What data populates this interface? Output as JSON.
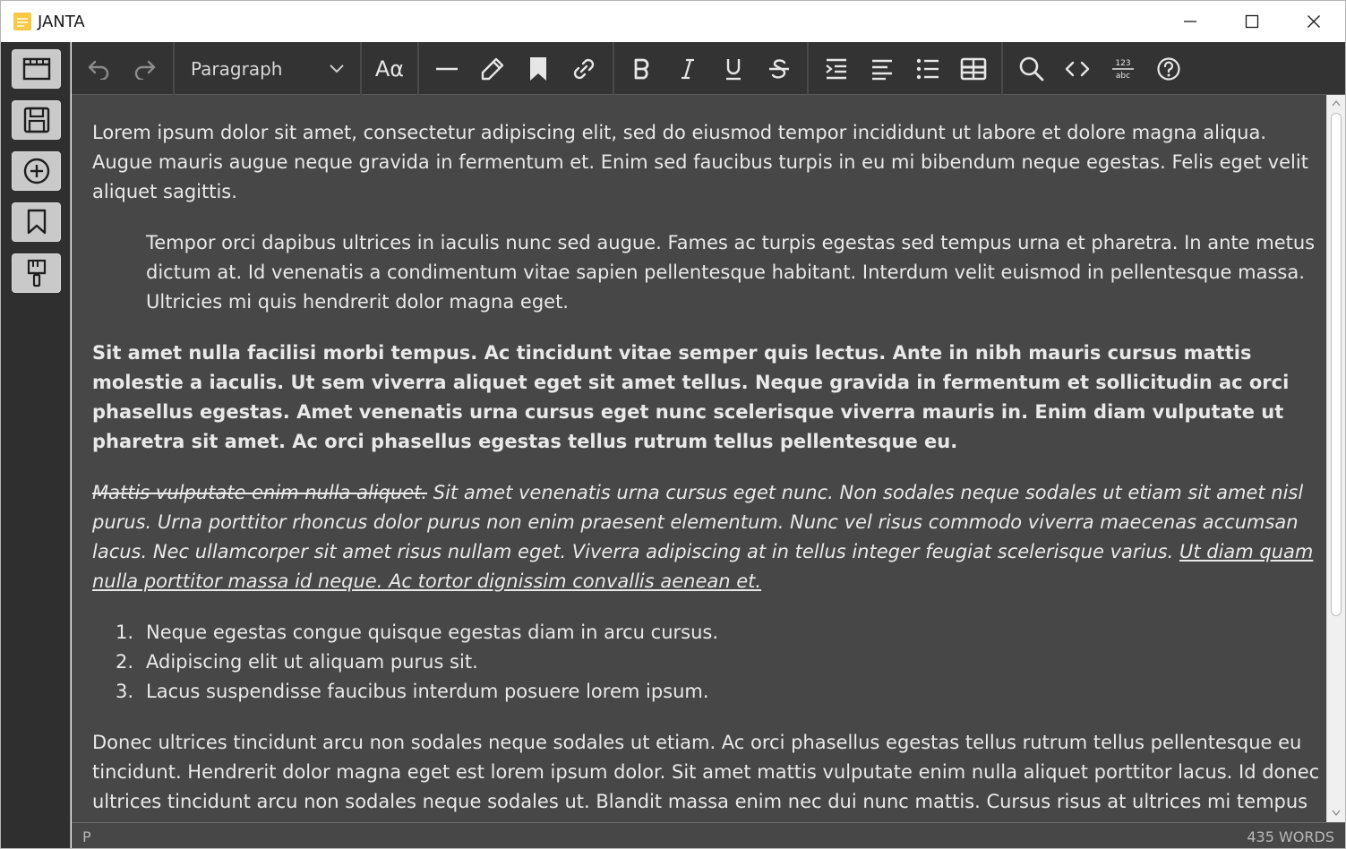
{
  "window": {
    "title": "JANTA",
    "minimize_icon": "minimize-icon",
    "maximize_icon": "maximize-icon",
    "close_icon": "close-icon"
  },
  "sidebar": {
    "items": [
      {
        "name": "open-file",
        "icon": "folder-icon"
      },
      {
        "name": "save",
        "icon": "floppy-disk-icon"
      },
      {
        "name": "new",
        "icon": "plus-circle-icon"
      },
      {
        "name": "bookmarks",
        "icon": "bookmark-icon"
      },
      {
        "name": "theme",
        "icon": "paintbrush-icon"
      }
    ]
  },
  "toolbar": {
    "paragraph_style": "Paragraph",
    "font_label": "Aα",
    "items": [
      "undo-icon",
      "redo-icon",
      "font-size-icon",
      "horizontal-rule-icon",
      "highlighter-icon",
      "bookmark-icon",
      "link-icon",
      "bold-icon",
      "italic-icon",
      "underline-icon",
      "strikethrough-icon",
      "indent-icon",
      "align-left-icon",
      "bullet-list-icon",
      "table-icon",
      "search-icon",
      "code-icon",
      "word-count-icon",
      "help-icon"
    ]
  },
  "editor": {
    "p1": "Lorem ipsum dolor sit amet, consectetur adipiscing elit, sed do eiusmod tempor incididunt ut labore et dolore magna aliqua. Augue mauris augue neque gravida in fermentum et. Enim sed faucibus turpis in eu mi bibendum neque egestas. Felis eget velit aliquet sagittis.",
    "p2": "Tempor orci dapibus ultrices in iaculis nunc sed augue. Fames ac turpis egestas sed tempus urna et pharetra. In ante metus dictum at. Id venenatis a condimentum vitae sapien pellentesque habitant. Interdum velit euismod in pellentesque massa. Ultricies mi quis hendrerit dolor magna eget.",
    "p3": "Sit amet nulla facilisi morbi tempus. Ac tincidunt vitae semper quis lectus. Ante in nibh mauris cursus mattis molestie a iaculis. Ut sem viverra aliquet eget sit amet tellus. Neque gravida in fermentum et sollicitudin ac orci phasellus egestas. Amet venenatis urna cursus eget nunc scelerisque viverra mauris in. Enim diam vulputate ut pharetra sit amet. Ac orci phasellus egestas tellus rutrum tellus pellentesque eu.",
    "p4_strike": "Mattis vulputate enim nulla aliquet.",
    "p4_italic": " Sit amet venenatis urna cursus eget nunc. Non sodales neque sodales ut etiam sit amet nisl purus. Urna porttitor rhoncus dolor purus non enim praesent elementum. Nunc vel risus commodo viverra maecenas accumsan lacus. Nec ullamcorper sit amet risus nullam eget. Viverra adipiscing at in tellus integer feugiat scelerisque varius. ",
    "p4_underline": "Ut diam quam nulla porttitor massa id neque. Ac tortor dignissim convallis aenean et.",
    "list": [
      {
        "num": "1.",
        "text": "Neque egestas congue quisque egestas diam in arcu cursus."
      },
      {
        "num": "2.",
        "text": "Adipiscing elit ut aliquam purus sit."
      },
      {
        "num": "3.",
        "text": "Lacus suspendisse faucibus interdum posuere lorem ipsum."
      }
    ],
    "p5": "Donec ultrices tincidunt arcu non sodales neque sodales ut etiam. Ac orci phasellus egestas tellus rutrum tellus pellentesque eu tincidunt. Hendrerit dolor magna eget est lorem ipsum dolor. Sit amet mattis vulputate enim nulla aliquet porttitor lacus. Id donec ultrices tincidunt arcu non sodales neque sodales ut. Blandit massa enim nec dui nunc mattis. Cursus risus at ultrices mi tempus"
  },
  "statusbar": {
    "element": "P",
    "word_count": "435 WORDS"
  }
}
